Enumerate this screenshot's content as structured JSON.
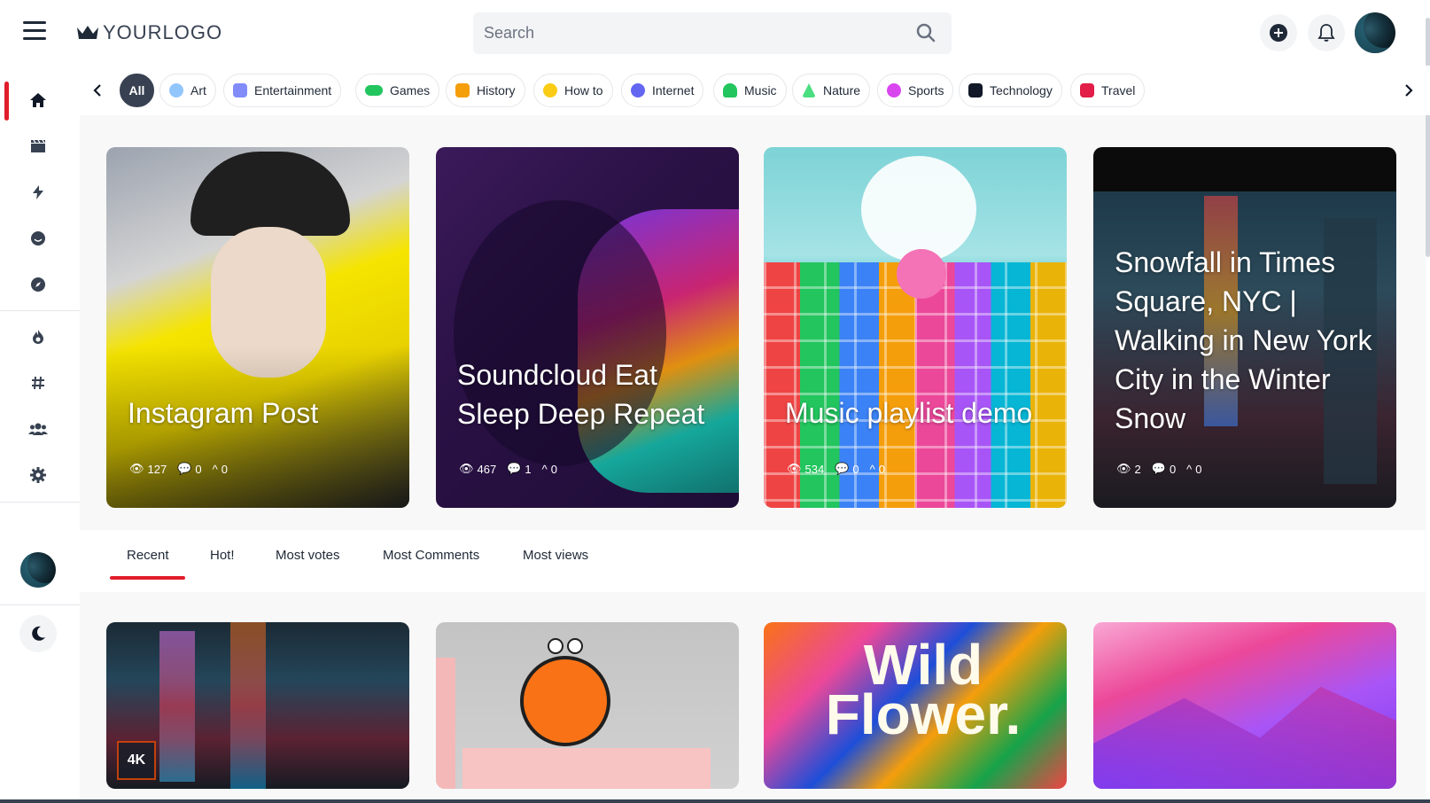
{
  "header": {
    "logo_text": "YOURLOGO",
    "search_placeholder": "Search",
    "icons": [
      "menu-icon",
      "crown-icon",
      "search-icon",
      "plus-circle-icon",
      "bell-icon"
    ]
  },
  "sidebar": {
    "items": [
      {
        "icon": "home-icon",
        "active": true
      },
      {
        "icon": "clapperboard-icon"
      },
      {
        "icon": "bolt-icon"
      },
      {
        "icon": "smile-icon"
      },
      {
        "icon": "compass-icon"
      },
      {
        "icon": "fire-icon"
      },
      {
        "icon": "hashtag-icon"
      },
      {
        "icon": "users-icon"
      },
      {
        "icon": "gear-icon"
      }
    ],
    "theme_toggle_icon": "moon-icon"
  },
  "categories": {
    "items": [
      {
        "label": "All",
        "active": true
      },
      {
        "label": "Art",
        "color": "#93c5fd"
      },
      {
        "label": "Entertainment",
        "color": "#818cf8"
      },
      {
        "label": "Games",
        "color": "#22c55e"
      },
      {
        "label": "History",
        "color": "#f59e0b"
      },
      {
        "label": "How to",
        "color": "#facc15"
      },
      {
        "label": "Internet",
        "color": "#6366f1"
      },
      {
        "label": "Music",
        "color": "#22c55e"
      },
      {
        "label": "Nature",
        "color": "#4ade80"
      },
      {
        "label": "Sports",
        "color": "#d946ef"
      },
      {
        "label": "Technology",
        "color": "#111827"
      },
      {
        "label": "Travel",
        "color": "#e11d48"
      }
    ]
  },
  "featured": [
    {
      "title": "Instagram Post",
      "views": "127",
      "comments": "0",
      "votes": "0"
    },
    {
      "title": "Soundcloud Eat Sleep Deep Repeat",
      "views": "467",
      "comments": "1",
      "votes": "0"
    },
    {
      "title": "Music playlist demo",
      "views": "534",
      "comments": "0",
      "votes": "0"
    },
    {
      "title": "Snowfall in Times Square, NYC | Walking in New York City in the Winter Snow",
      "views": "2",
      "comments": "0",
      "votes": "0"
    }
  ],
  "tabs": [
    {
      "label": "Recent",
      "active": true
    },
    {
      "label": "Hot!"
    },
    {
      "label": "Most votes"
    },
    {
      "label": "Most Comments"
    },
    {
      "label": "Most views"
    }
  ],
  "thumbs": [
    {
      "badge": "4K"
    },
    {
      "overlay": ""
    },
    {
      "overlay": "Wild Flower."
    },
    {
      "overlay": ""
    }
  ],
  "colors": {
    "accent": "#e11d2a",
    "chip_active_bg": "#374151",
    "main_bg": "#f8f8f8"
  }
}
